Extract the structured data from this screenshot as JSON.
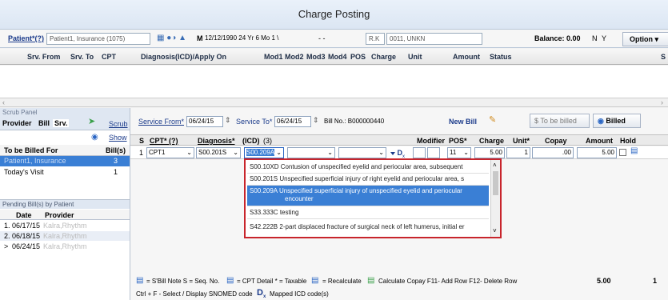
{
  "window": {
    "title": "Charge Posting"
  },
  "patient_bar": {
    "patient_label": "Patient*(?)",
    "patient_value": "Patient1, Insurance (1075)",
    "dob_info": "12/12/1990 24 Yr 6 Mo 1 \\",
    "dash": "- -",
    "provider_code": "R.K",
    "location": "0011, UNKN",
    "balance": "Balance: 0.00",
    "n": "N",
    "y": "Y",
    "option": "Option"
  },
  "columns": [
    "Srv. From",
    "Srv. To",
    "CPT",
    "Diagnosis(ICD)/Apply On",
    "Mod1",
    "Mod2",
    "Mod3",
    "Mod4",
    "POS",
    "Charge",
    "Unit",
    "Amount",
    "Status",
    "S"
  ],
  "scrub_panel": {
    "title": "Scrub Panel",
    "tabs": [
      "Provider",
      "Bill",
      "Srv."
    ],
    "scrub_label": "Scrub",
    "show_label": "Show",
    "header_for": "To be Billed For",
    "header_bills": "Bill(s)",
    "rows": [
      {
        "name": "Patient1, Insurance",
        "count": "3"
      },
      {
        "name": "Today's Visit",
        "count": "1"
      }
    ]
  },
  "pending": {
    "title": "Pending Bill(s) by Patient",
    "header_date": "Date",
    "header_provider": "Provider",
    "rows": [
      {
        "idx": "1.",
        "date": "06/17/15",
        "provider": "Kalra,Rhythm"
      },
      {
        "idx": "2.",
        "date": "06/18/15",
        "provider": "Kalra,Rhythm"
      },
      {
        "idx": ">",
        "date": "06/24/15",
        "provider": "Kalra,Rhythm"
      }
    ]
  },
  "service": {
    "from_label": "Service From*",
    "from_value": "06/24/15",
    "to_label": "Service To*",
    "to_value": "06/24/15",
    "bill_no": "Bill No.: B000000440",
    "new_bill": "New Bill",
    "to_be_billed": "To be billed",
    "billed": "Billed"
  },
  "grid": {
    "headers": [
      "S",
      "CPT* (?)",
      "Diagnosis*",
      "(ICD)",
      "(3)",
      "Modifier",
      "POS*",
      "Charge",
      "Unit*",
      "Copay",
      "Amount",
      "Hold"
    ],
    "row": {
      "s": "1",
      "cpt": "CPT1",
      "diag1": "S00.201S",
      "diag2": "S00.209A",
      "dx": "D",
      "pos": "11",
      "charge": "5.00",
      "unit": "1",
      "copay": ".00",
      "amount": "5.00"
    }
  },
  "dropdown_items": [
    {
      "code": "S00.10XD",
      "desc": "Contusion of unspecified eyelid and periocular area, subsequent"
    },
    {
      "code": "S00.201S",
      "desc": "Unspecified superficial injury of right eyelid and periocular area, s"
    },
    {
      "code": "S00.209A",
      "desc": "Unspecified superficial injury of unspecified eyelid and periocular",
      "desc2": "encounter"
    },
    {
      "code": "S33.333C",
      "desc": "testing"
    },
    {
      "code": "S42.222B",
      "desc": "2-part displaced fracture of surgical neck of left humerus, initial er"
    }
  ],
  "footer": {
    "legend1": "= S'Bill Note S = Seq. No.",
    "legend2": "= CPT Detail * = Taxable",
    "legend3": "= Recalculate",
    "legend4": "Calculate Copay  F11- Add Row  F12- Delete Row",
    "total": "5.00",
    "count": "1",
    "line2": "Ctrl + F - Select / Display SNOMED code",
    "line2b": "Mapped ICD code(s)"
  }
}
